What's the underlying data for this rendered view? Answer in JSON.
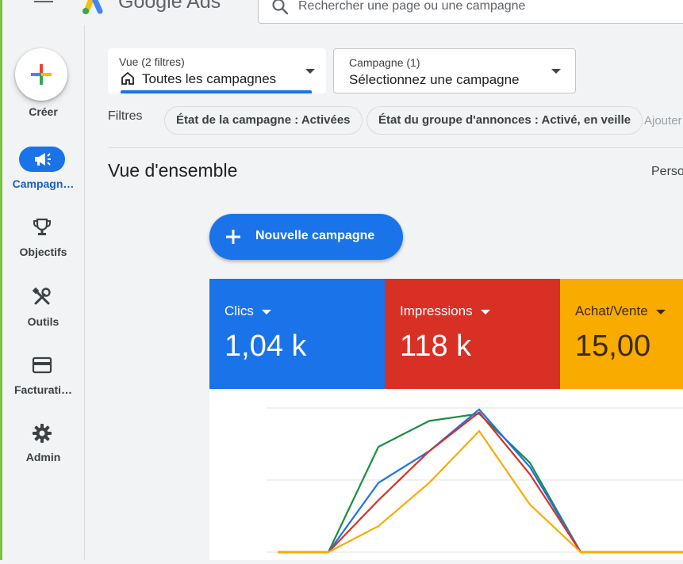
{
  "header": {
    "brand": "Google Ads",
    "search_placeholder": "Rechercher une page ou une campagne"
  },
  "sidebar": {
    "create_label": "Créer",
    "items": [
      {
        "label": "Campagn…",
        "icon": "megaphone-icon",
        "active": true
      },
      {
        "label": "Objectifs",
        "icon": "trophy-icon",
        "active": false
      },
      {
        "label": "Outils",
        "icon": "tools-icon",
        "active": false
      },
      {
        "label": "Facturati…",
        "icon": "credit-card-icon",
        "active": false
      },
      {
        "label": "Admin",
        "icon": "gear-icon",
        "active": false
      }
    ]
  },
  "view_selector": {
    "caption": "Vue (2 filtres)",
    "value": "Toutes les campagnes",
    "icon": "home-icon"
  },
  "campaign_selector": {
    "caption": "Campagne (1)",
    "value": "Sélectionnez une campagne"
  },
  "filters": {
    "label": "Filtres",
    "chips": [
      "État de la campagne : Activées",
      "État du groupe d'annonces : Activé, en veille"
    ],
    "add_label": "Ajouter"
  },
  "overview": {
    "title": "Vue d'ensemble",
    "customize_label": "Perso"
  },
  "new_campaign_button": "Nouvelle campagne",
  "metrics": [
    {
      "label": "Clics",
      "value": "1,04 k",
      "color": "#1a73e8"
    },
    {
      "label": "Impressions",
      "value": "118 k",
      "color": "#d93025"
    },
    {
      "label": "Achat/Vente",
      "value": "15,00",
      "color": "#f9ab00"
    }
  ],
  "chart_data": {
    "type": "line",
    "x": [
      0,
      1,
      2,
      3,
      4,
      5,
      6,
      7,
      8
    ],
    "ylim": [
      0,
      1
    ],
    "grid": true,
    "series": [
      {
        "color": "#1e8e3e",
        "values": [
          0,
          0,
          0.73,
          0.91,
          0.96,
          0.62,
          0,
          0,
          0
        ]
      },
      {
        "color": "#1a73e8",
        "values": [
          0,
          0,
          0.48,
          0.7,
          0.99,
          0.59,
          0,
          0,
          0
        ]
      },
      {
        "color": "#d93025",
        "values": [
          0,
          0,
          0.36,
          0.7,
          0.97,
          0.54,
          0,
          0,
          0
        ]
      },
      {
        "color": "#f9ab00",
        "values": [
          0,
          0,
          0.18,
          0.48,
          0.84,
          0.33,
          0,
          0,
          0
        ]
      }
    ]
  }
}
